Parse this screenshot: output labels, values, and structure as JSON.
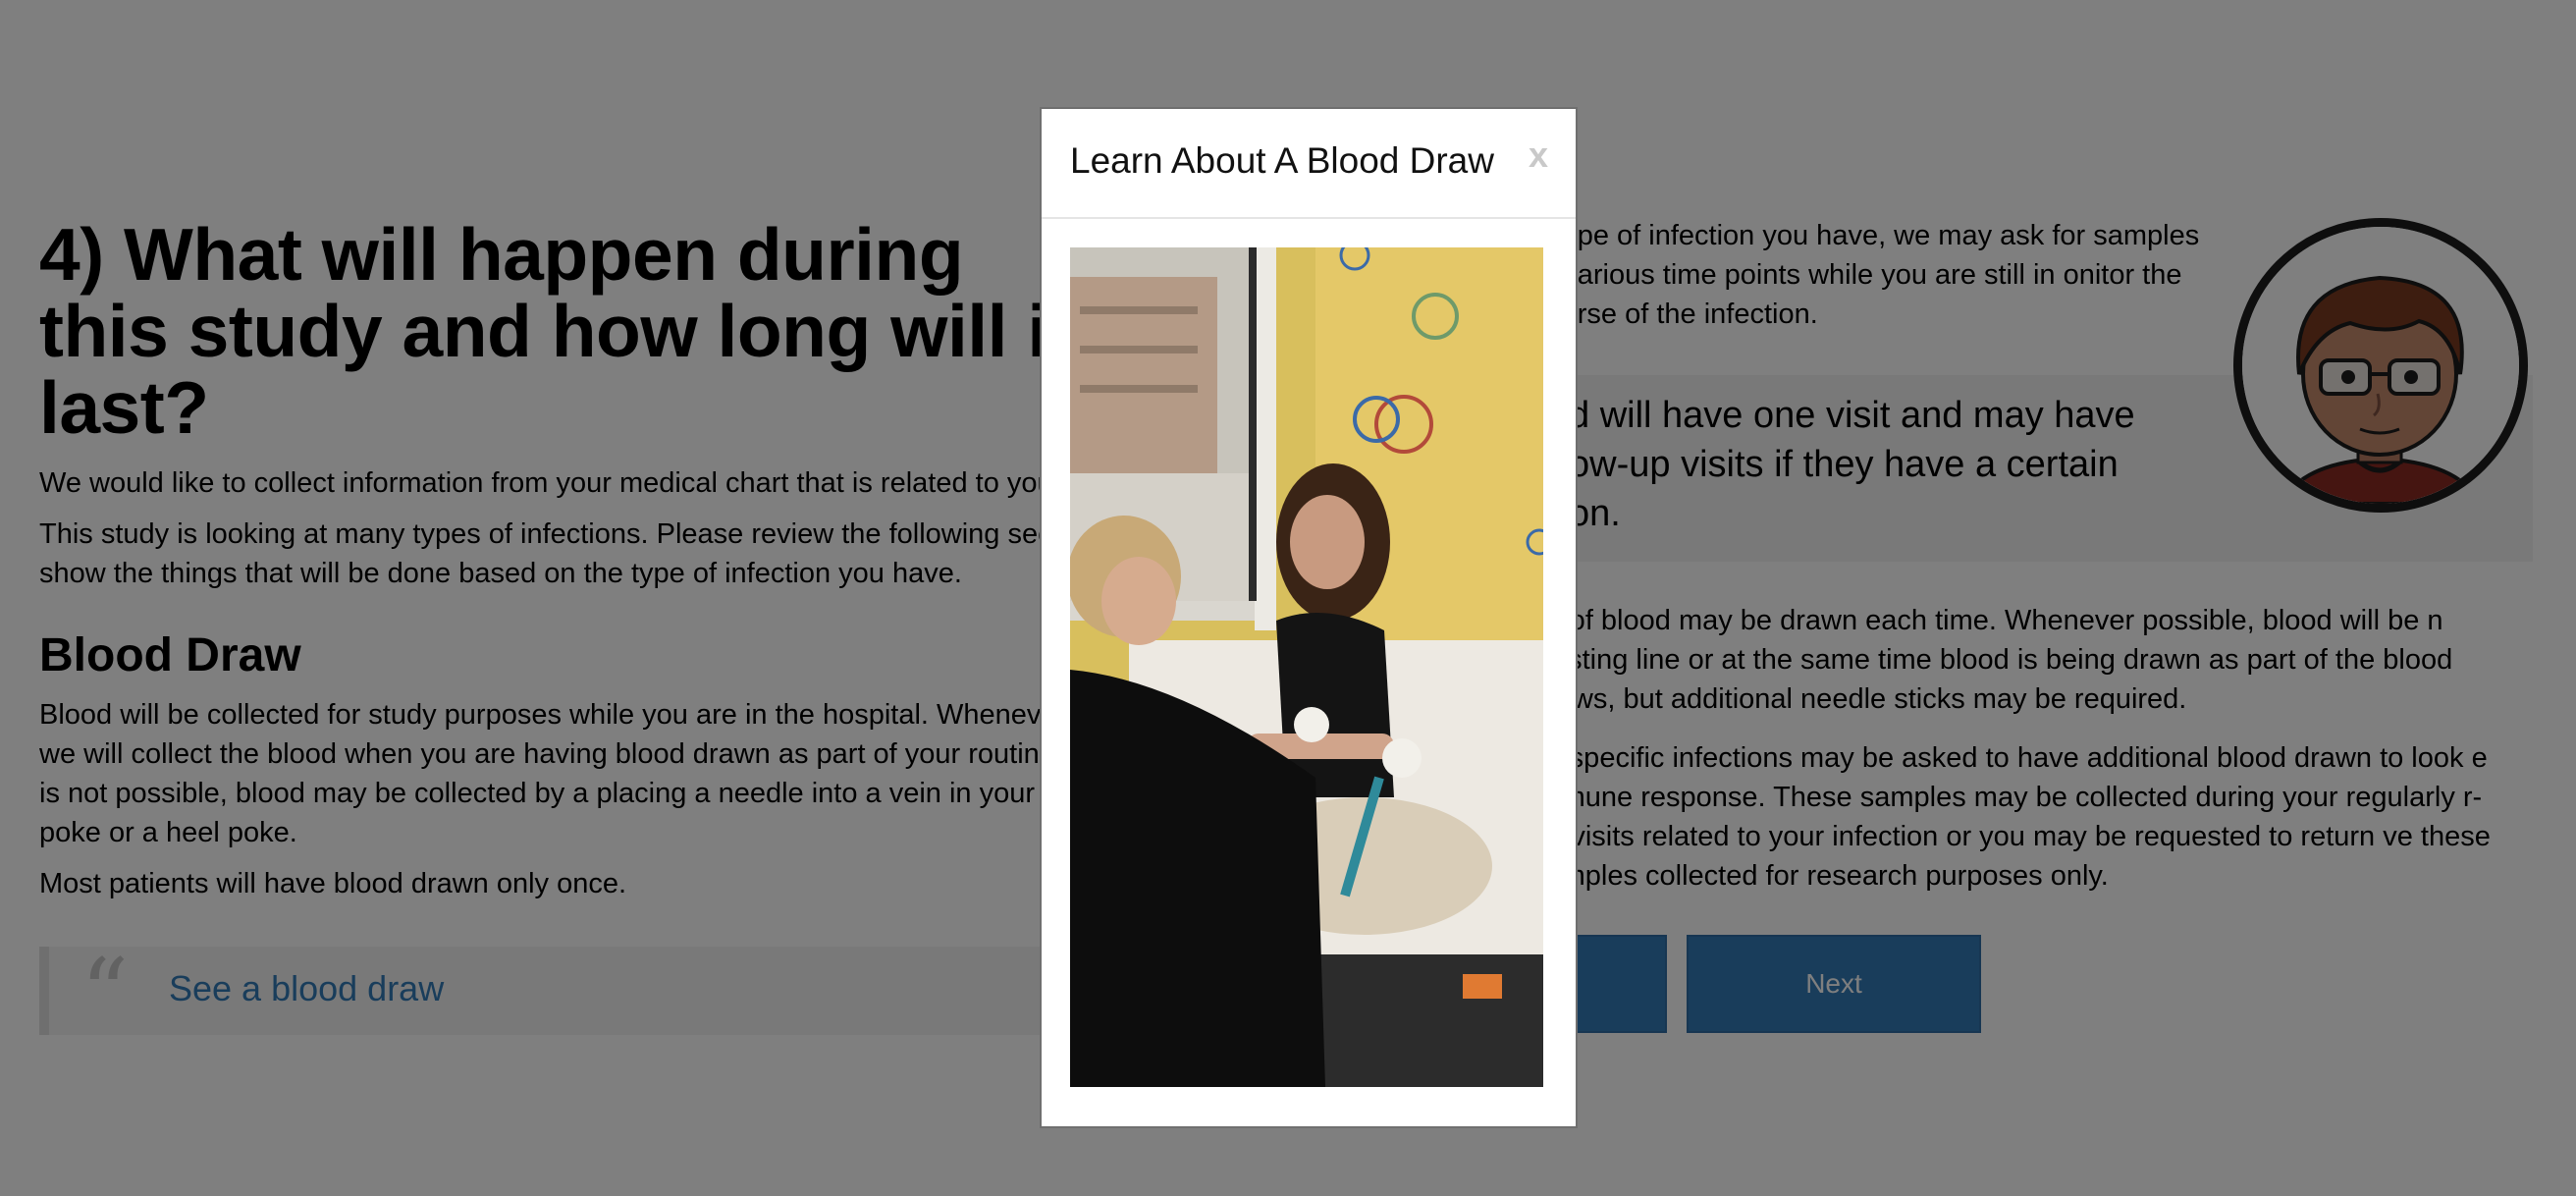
{
  "page": {
    "title": "4) What will happen during this study and how long will it last?",
    "para_chart": "We would like to collect information from your medical chart that is related to your",
    "para_types": "This study is looking at many types of infections. Please review the following secti show the things that will be done based on the type of infection you have.",
    "blood_draw_heading": "Blood Draw",
    "blood_draw_para": "Blood will be collected for study purposes while you are in the hospital. Whenever we will collect the blood when you are having blood drawn as part of your routine is not possible, blood may be collected by a placing a needle into a vein in your ar poke or a heel poke.",
    "blood_once": "Most patients will have blood drawn only once.",
    "quote_mark": "“",
    "see_link": "See a blood draw",
    "right_intro": "e type of infection you have, we may ask for samples at various time points while you are still in onitor the course of the infection.",
    "callout": "hild will have one visit and may have ollow-up visits if they have a certain ction.",
    "right_para1": "ns of blood may be drawn each time. Whenever possible, blood will be n existing line or at the same time blood is being drawn as part of the blood draws, but additional needle sticks may be required.",
    "right_para2": "ith specific infections may be asked to have additional blood drawn to look e immune response. These samples may be collected during your regularly r-up visits related to your infection or you may be requested to return ve these samples collected for research purposes only.",
    "back_label": "",
    "next_label": "Next"
  },
  "modal": {
    "title": "Learn About A Blood Draw",
    "close": "x"
  },
  "colors": {
    "overlay": "rgba(0,0,0,0.5)",
    "link": "#337ab7",
    "button": "#337ab7"
  },
  "icons": {
    "quote": "quote-icon",
    "avatar": "avatar-illustration",
    "close": "close-icon"
  }
}
